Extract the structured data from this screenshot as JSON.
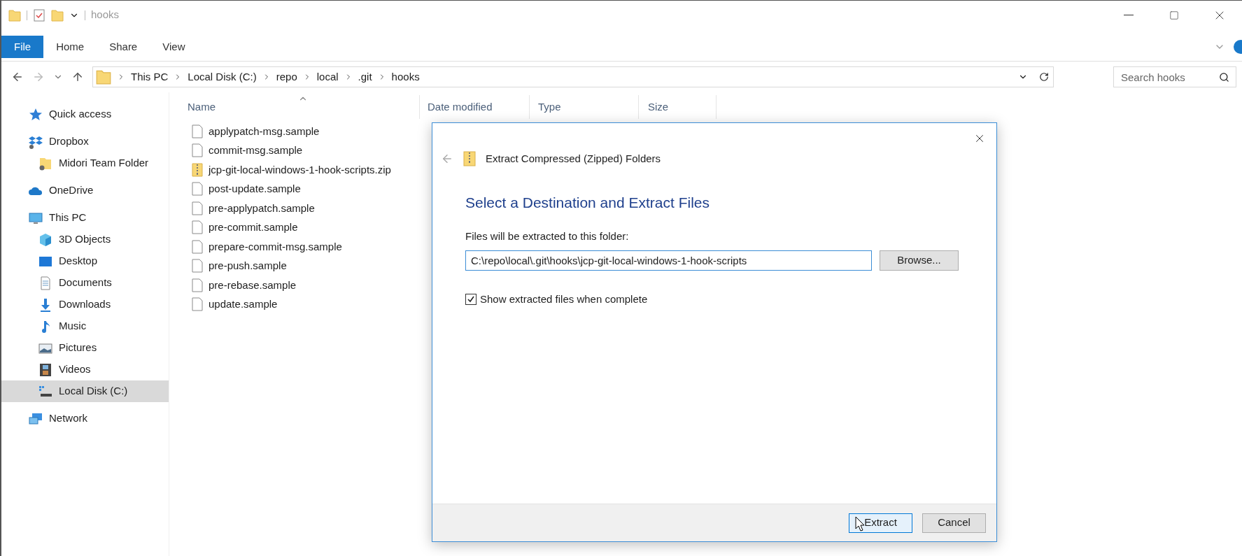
{
  "window": {
    "title": "hooks"
  },
  "ribbon_tabs": [
    {
      "label": "File",
      "selected": true
    },
    {
      "label": "Home",
      "selected": false
    },
    {
      "label": "Share",
      "selected": false
    },
    {
      "label": "View",
      "selected": false
    }
  ],
  "address_bar": {
    "breadcrumbs": [
      "This PC",
      "Local Disk (C:)",
      "repo",
      "local",
      ".git",
      "hooks"
    ]
  },
  "search": {
    "placeholder": "Search hooks"
  },
  "sidebar": {
    "items": [
      {
        "label": "Quick access",
        "kind": "star",
        "selected": false
      },
      {
        "label": "Dropbox",
        "kind": "dropbox",
        "selected": false,
        "children": [
          {
            "label": "Midori Team Folder",
            "kind": "team-folder",
            "selected": false
          }
        ]
      },
      {
        "label": "OneDrive",
        "kind": "cloud",
        "selected": false
      },
      {
        "label": "This PC",
        "kind": "computer",
        "selected": false,
        "children": [
          {
            "label": "3D Objects",
            "kind": "cube",
            "selected": false
          },
          {
            "label": "Desktop",
            "kind": "desktop",
            "selected": false
          },
          {
            "label": "Documents",
            "kind": "document",
            "selected": false
          },
          {
            "label": "Downloads",
            "kind": "download",
            "selected": false
          },
          {
            "label": "Music",
            "kind": "music",
            "selected": false
          },
          {
            "label": "Pictures",
            "kind": "pictures",
            "selected": false
          },
          {
            "label": "Videos",
            "kind": "film",
            "selected": false
          },
          {
            "label": "Local Disk (C:)",
            "kind": "drive",
            "selected": true
          }
        ]
      },
      {
        "label": "Network",
        "kind": "network",
        "selected": false
      }
    ]
  },
  "file_list": {
    "columns": [
      {
        "label": "Name",
        "sorted": true
      },
      {
        "label": "Date modified",
        "sorted": false
      },
      {
        "label": "Type",
        "sorted": false
      },
      {
        "label": "Size",
        "sorted": false
      }
    ],
    "rows": [
      {
        "name": "applypatch-msg.sample",
        "kind": "file"
      },
      {
        "name": "commit-msg.sample",
        "kind": "file"
      },
      {
        "name": "jcp-git-local-windows-1-hook-scripts.zip",
        "kind": "zip"
      },
      {
        "name": "post-update.sample",
        "kind": "file"
      },
      {
        "name": "pre-applypatch.sample",
        "kind": "file"
      },
      {
        "name": "pre-commit.sample",
        "kind": "file"
      },
      {
        "name": "prepare-commit-msg.sample",
        "kind": "file"
      },
      {
        "name": "pre-push.sample",
        "kind": "file"
      },
      {
        "name": "pre-rebase.sample",
        "kind": "file"
      },
      {
        "name": "update.sample",
        "kind": "file"
      }
    ]
  },
  "dialog": {
    "title": "Extract Compressed (Zipped) Folders",
    "heading": "Select a Destination and Extract Files",
    "field_label": "Files will be extracted to this folder:",
    "path": "C:\\repo\\local\\.git\\hooks\\jcp-git-local-windows-1-hook-scripts",
    "browse_button": "Browse...",
    "show_files": {
      "label": "Show extracted files when complete",
      "checked": true
    },
    "buttons": [
      {
        "label": "Extract",
        "default": true
      },
      {
        "label": "Cancel",
        "default": false
      }
    ]
  }
}
